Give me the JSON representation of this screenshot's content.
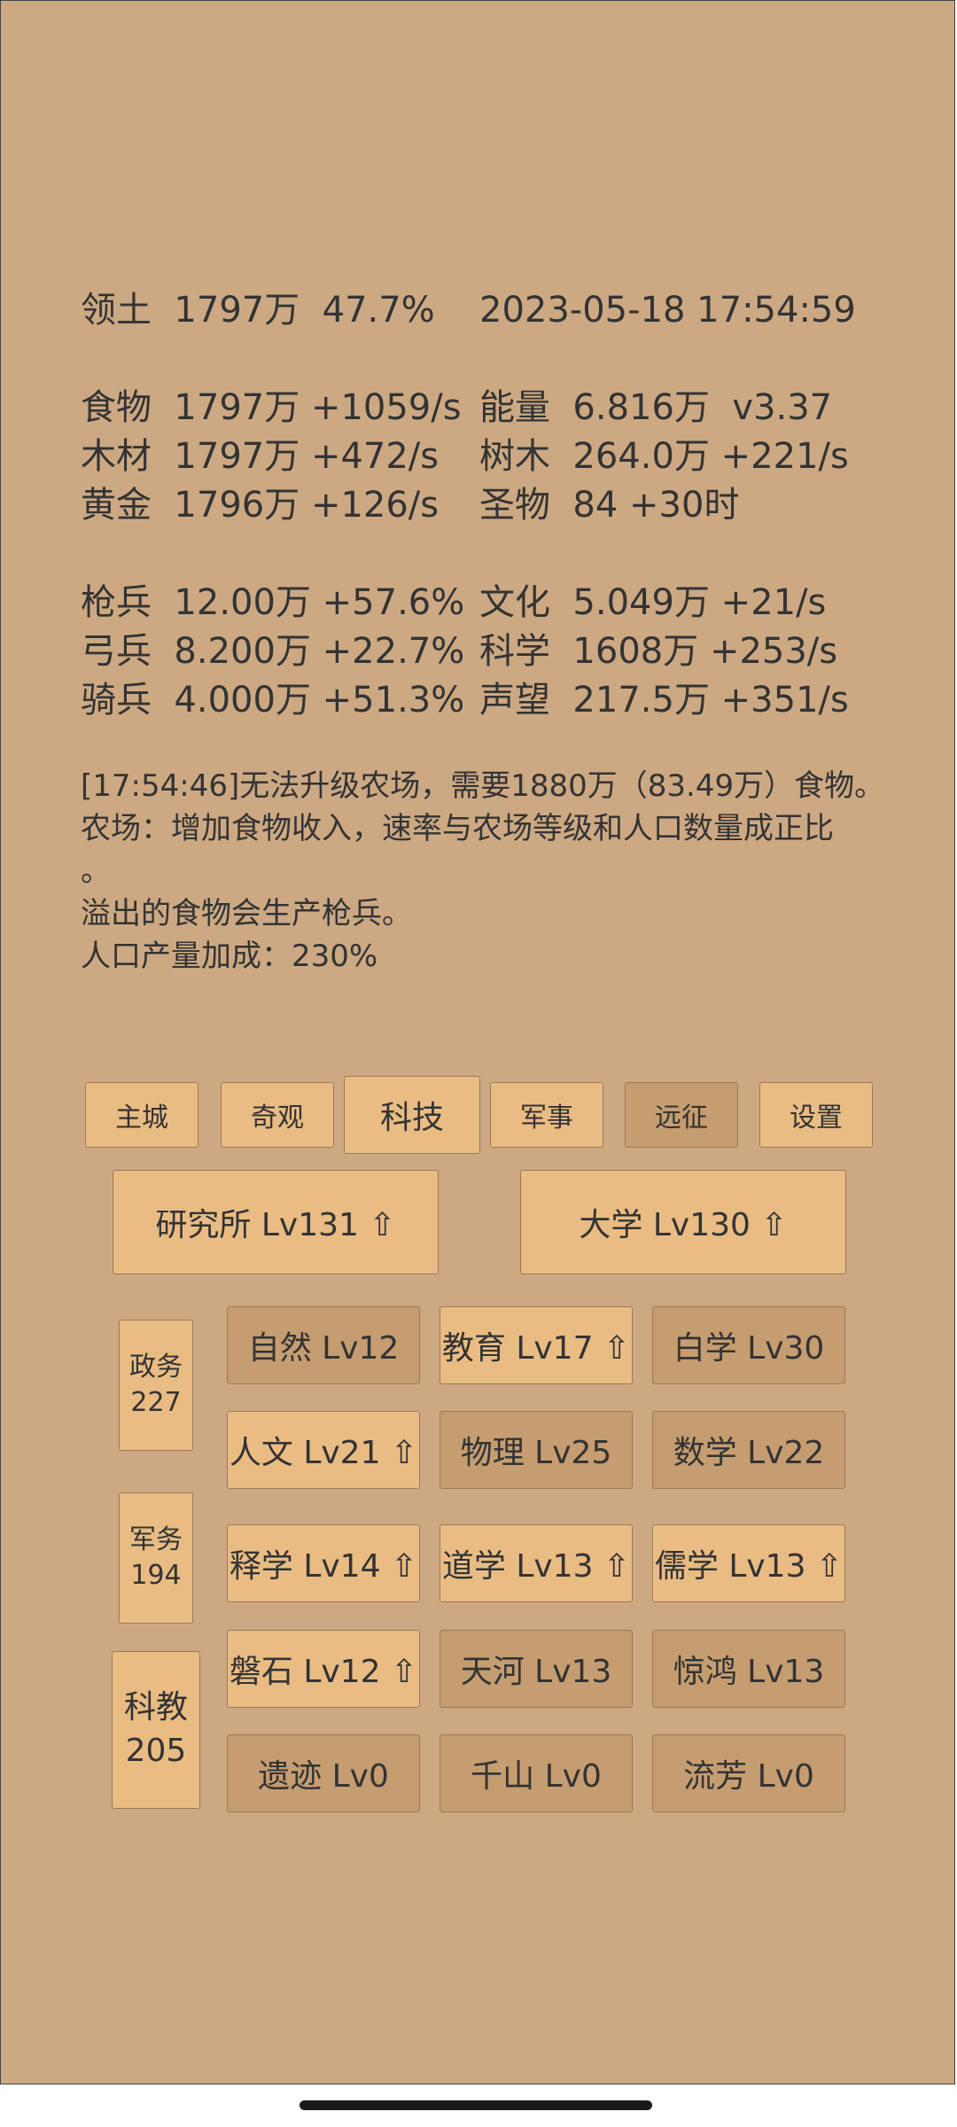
{
  "stats": {
    "territory": "领土  1797万  47.7%",
    "datetime": "2023-05-18 17:54:59",
    "left": [
      "食物  1797万 +1059/s",
      "木材  1797万 +472/s",
      "黄金  1796万 +126/s",
      "枪兵  12.00万 +57.6%",
      "弓兵  8.200万 +22.7%",
      "骑兵  4.000万 +51.3%"
    ],
    "right": [
      "能量  6.816万  v3.37",
      "树木  264.0万 +221/s",
      "圣物  84 +30时",
      "文化  5.049万 +21/s",
      "科学  1608万 +253/s",
      "声望  217.5万 +351/s"
    ]
  },
  "message": {
    "lines": [
      "[17:54:46]无法升级农场，需要1880万（83.49万）食物。",
      "农场：增加食物收入，速率与农场等级和人口数量成正比",
      "。",
      "溢出的食物会生产枪兵。",
      "人口产量加成：230%"
    ]
  },
  "tabs": [
    "主城",
    "奇观",
    "科技",
    "军事",
    "远征",
    "设置"
  ],
  "active_tab": "科技",
  "buildings": [
    "研究所 Lv131 ⇧",
    "大学 Lv130 ⇧"
  ],
  "side": [
    "政务\n227",
    "军务\n194",
    "科教\n205"
  ],
  "techs": [
    [
      "自然 Lv12",
      "教育 Lv17 ⇧",
      "白学 Lv30"
    ],
    [
      "人文 Lv21 ⇧",
      "物理 Lv25",
      "数学 Lv22"
    ],
    [
      "释学 Lv14 ⇧",
      "道学 Lv13 ⇧",
      "儒学 Lv13 ⇧"
    ],
    [
      "磐石 Lv12 ⇧",
      "天河 Lv13",
      "惊鸿 Lv13"
    ],
    [
      "遗迹 Lv0",
      "千山 Lv0",
      "流芳 Lv0"
    ]
  ],
  "colors": {
    "background": "#cca983",
    "button_light": "#e9bc84",
    "button_dark": "#c59d70",
    "text": "#333333"
  }
}
